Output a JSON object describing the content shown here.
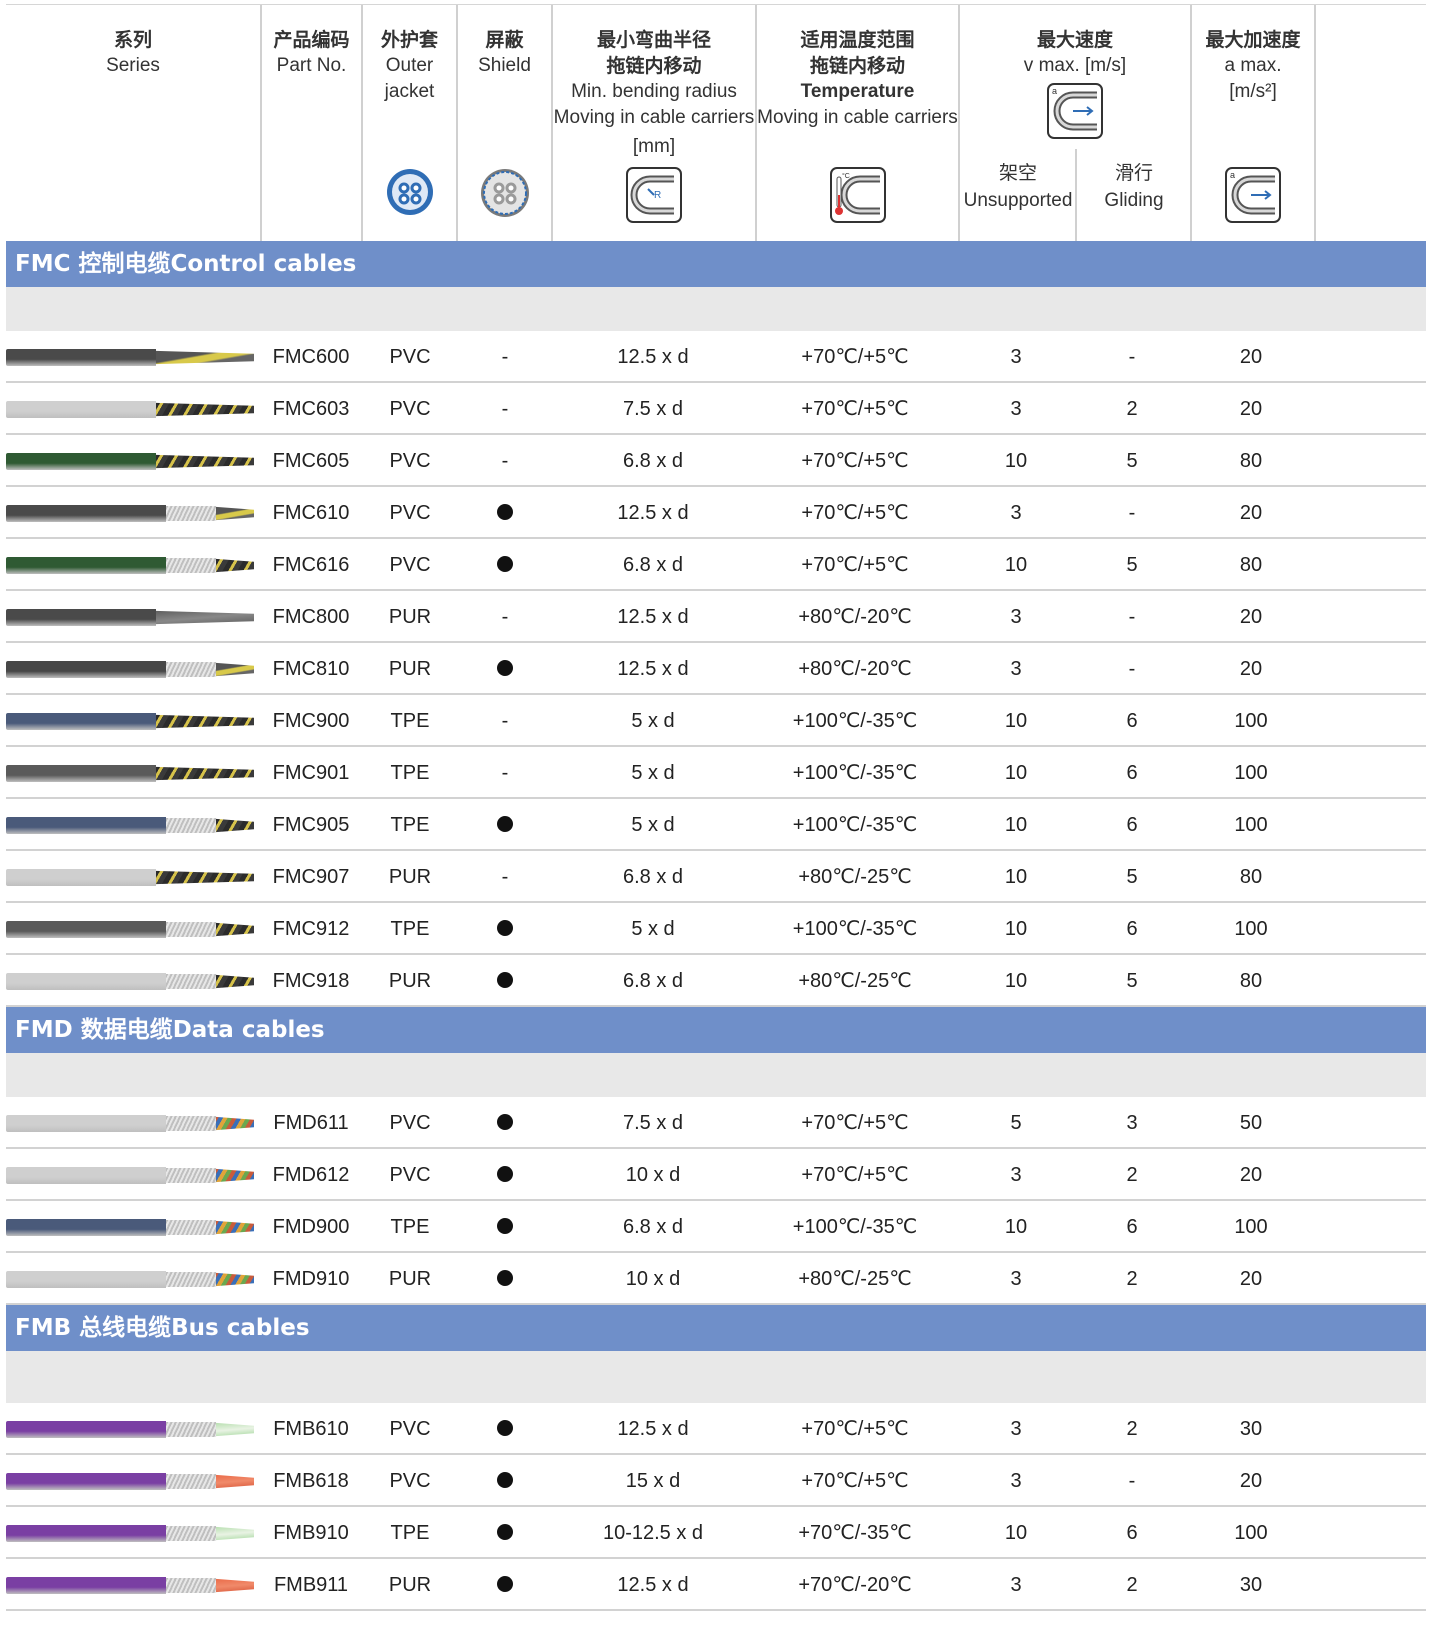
{
  "header": {
    "series": {
      "zh": "系列",
      "en": "Series"
    },
    "part": {
      "zh": "产品编码",
      "en": "Part No."
    },
    "jacket": {
      "zh": "外护套",
      "en1": "Outer",
      "en2": "jacket"
    },
    "shield": {
      "zh": "屏蔽",
      "en": "Shield"
    },
    "bend": {
      "zh1": "最小弯曲半径",
      "zh2": "拖链内移动",
      "en1": "Min. bending radius",
      "en2": "Moving in cable carriers",
      "unit": "[mm]"
    },
    "temp": {
      "zh1": "适用温度范围",
      "zh2": "拖链内移动",
      "en1": "Temperature",
      "en2": "Moving in cable carriers"
    },
    "speed": {
      "zh": "最大速度",
      "en": "v max. [m/s]",
      "unsupported": {
        "zh": "架空",
        "en": "Unsupported"
      },
      "gliding": {
        "zh": "滑行",
        "en": "Gliding"
      }
    },
    "accel": {
      "zh": "最大加速度",
      "en1": "a max.",
      "en2": "[m/s²]"
    }
  },
  "sections": [
    {
      "title": "FMC 控制电缆Control cables",
      "rows": [
        {
          "part": "FMC600",
          "jacket": "PVC",
          "shield": false,
          "bend": "12.5 x d",
          "temp": "+70℃/+5℃",
          "unsupported": "3",
          "gliding": "-",
          "accel": "20",
          "color": "#4a4a4a",
          "core": "yellow"
        },
        {
          "part": "FMC603",
          "jacket": "PVC",
          "shield": false,
          "bend": "7.5 x d",
          "temp": "+70℃/+5℃",
          "unsupported": "3",
          "gliding": "2",
          "accel": "20",
          "color": "#cfcfcf",
          "core": "twisted"
        },
        {
          "part": "FMC605",
          "jacket": "PVC",
          "shield": false,
          "bend": "6.8 x d",
          "temp": "+70℃/+5℃",
          "unsupported": "10",
          "gliding": "5",
          "accel": "80",
          "color": "#2f5a33",
          "core": "twisted"
        },
        {
          "part": "FMC610",
          "jacket": "PVC",
          "shield": true,
          "bend": "12.5 x d",
          "temp": "+70℃/+5℃",
          "unsupported": "3",
          "gliding": "-",
          "accel": "20",
          "color": "#4a4a4a",
          "core": "yellow"
        },
        {
          "part": "FMC616",
          "jacket": "PVC",
          "shield": true,
          "bend": "6.8 x d",
          "temp": "+70℃/+5℃",
          "unsupported": "10",
          "gliding": "5",
          "accel": "80",
          "color": "#2f5a33",
          "core": "twisted"
        },
        {
          "part": "FMC800",
          "jacket": "PUR",
          "shield": false,
          "bend": "12.5 x d",
          "temp": "+80℃/-20℃",
          "unsupported": "3",
          "gliding": "-",
          "accel": "20",
          "color": "#4a4a4a",
          "core": "grey"
        },
        {
          "part": "FMC810",
          "jacket": "PUR",
          "shield": true,
          "bend": "12.5 x d",
          "temp": "+80℃/-20℃",
          "unsupported": "3",
          "gliding": "-",
          "accel": "20",
          "color": "#474747",
          "core": "yellow"
        },
        {
          "part": "FMC900",
          "jacket": "TPE",
          "shield": false,
          "bend": "5 x d",
          "temp": "+100℃/-35℃",
          "unsupported": "10",
          "gliding": "6",
          "accel": "100",
          "color": "#4a5a7a",
          "core": "twisted"
        },
        {
          "part": "FMC901",
          "jacket": "TPE",
          "shield": false,
          "bend": "5 x d",
          "temp": "+100℃/-35℃",
          "unsupported": "10",
          "gliding": "6",
          "accel": "100",
          "color": "#5a5a5a",
          "core": "twisted"
        },
        {
          "part": "FMC905",
          "jacket": "TPE",
          "shield": true,
          "bend": "5 x d",
          "temp": "+100℃/-35℃",
          "unsupported": "10",
          "gliding": "6",
          "accel": "100",
          "color": "#4a5a7a",
          "core": "twisted"
        },
        {
          "part": "FMC907",
          "jacket": "PUR",
          "shield": false,
          "bend": "6.8 x d",
          "temp": "+80℃/-25℃",
          "unsupported": "10",
          "gliding": "5",
          "accel": "80",
          "color": "#cfcfcf",
          "core": "twisted"
        },
        {
          "part": "FMC912",
          "jacket": "TPE",
          "shield": true,
          "bend": "5 x d",
          "temp": "+100℃/-35℃",
          "unsupported": "10",
          "gliding": "6",
          "accel": "100",
          "color": "#5a5a5a",
          "core": "twisted"
        },
        {
          "part": "FMC918",
          "jacket": "PUR",
          "shield": true,
          "bend": "6.8 x d",
          "temp": "+80℃/-25℃",
          "unsupported": "10",
          "gliding": "5",
          "accel": "80",
          "color": "#cfcfcf",
          "core": "twisted"
        }
      ]
    },
    {
      "title": "FMD 数据电缆Data cables",
      "rows": [
        {
          "part": "FMD611",
          "jacket": "PVC",
          "shield": true,
          "bend": "7.5 x d",
          "temp": "+70℃/+5℃",
          "unsupported": "5",
          "gliding": "3",
          "accel": "50",
          "color": "#cfcfcf",
          "core": "color"
        },
        {
          "part": "FMD612",
          "jacket": "PVC",
          "shield": true,
          "bend": "10 x d",
          "temp": "+70℃/+5℃",
          "unsupported": "3",
          "gliding": "2",
          "accel": "20",
          "color": "#cfcfcf",
          "core": "color"
        },
        {
          "part": "FMD900",
          "jacket": "TPE",
          "shield": true,
          "bend": "6.8 x d",
          "temp": "+100℃/-35℃",
          "unsupported": "10",
          "gliding": "6",
          "accel": "100",
          "color": "#4a5a7a",
          "core": "color"
        },
        {
          "part": "FMD910",
          "jacket": "PUR",
          "shield": true,
          "bend": "10 x d",
          "temp": "+80℃/-25℃",
          "unsupported": "3",
          "gliding": "2",
          "accel": "20",
          "color": "#cfcfcf",
          "core": "color"
        }
      ]
    },
    {
      "title": "FMB 总线电缆Bus cables",
      "rows": [
        {
          "part": "FMB610",
          "jacket": "PVC",
          "shield": true,
          "bend": "12.5 x d",
          "temp": "+70℃/+5℃",
          "unsupported": "3",
          "gliding": "2",
          "accel": "30",
          "color": "#7a3fa3",
          "core": "green"
        },
        {
          "part": "FMB618",
          "jacket": "PVC",
          "shield": true,
          "bend": "15 x d",
          "temp": "+70℃/+5℃",
          "unsupported": "3",
          "gliding": "-",
          "accel": "20",
          "color": "#7a3fa3",
          "core": "red"
        },
        {
          "part": "FMB910",
          "jacket": "TPE",
          "shield": true,
          "bend": "10-12.5 x d",
          "temp": "+70℃/-35℃",
          "unsupported": "10",
          "gliding": "6",
          "accel": "100",
          "color": "#7a3fa3",
          "core": "green"
        },
        {
          "part": "FMB911",
          "jacket": "PUR",
          "shield": true,
          "bend": "12.5 x d",
          "temp": "+70℃/-20℃",
          "unsupported": "3",
          "gliding": "2",
          "accel": "30",
          "color": "#7a3fa3",
          "core": "red"
        }
      ]
    }
  ],
  "colors": {
    "section_bar": "#6f8fc9",
    "gap": "#e8e8e8",
    "icon_blue": "#2f6db5"
  },
  "icons": [
    "outer-jacket-icon",
    "shield-cross-section-icon",
    "bending-radius-icon",
    "temperature-icon",
    "speed-icon",
    "acceleration-icon"
  ]
}
